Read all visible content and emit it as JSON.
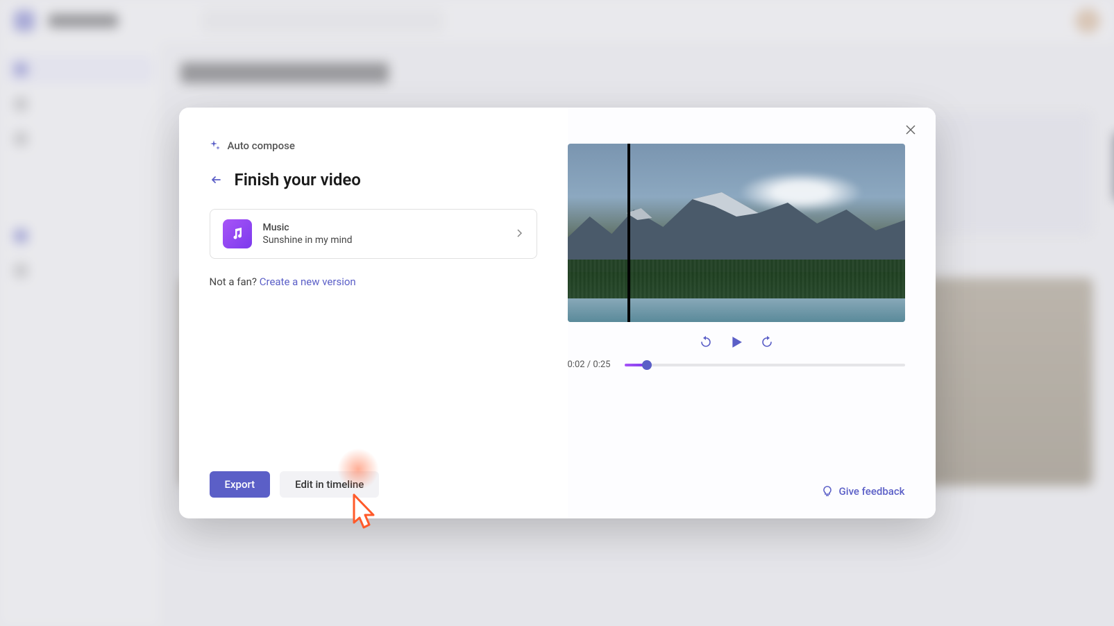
{
  "modal": {
    "autoComposeLabel": "Auto compose",
    "title": "Finish your video",
    "music": {
      "sectionLabel": "Music",
      "trackName": "Sunshine in my mind"
    },
    "notFanText": "Not a fan? ",
    "createNewLink": "Create a new version",
    "exportButton": "Export",
    "editTimelineButton": "Edit in timeline",
    "feedbackLabel": "Give feedback",
    "player": {
      "currentTime": "0:02",
      "totalTime": "0:25",
      "separator": " / "
    }
  }
}
